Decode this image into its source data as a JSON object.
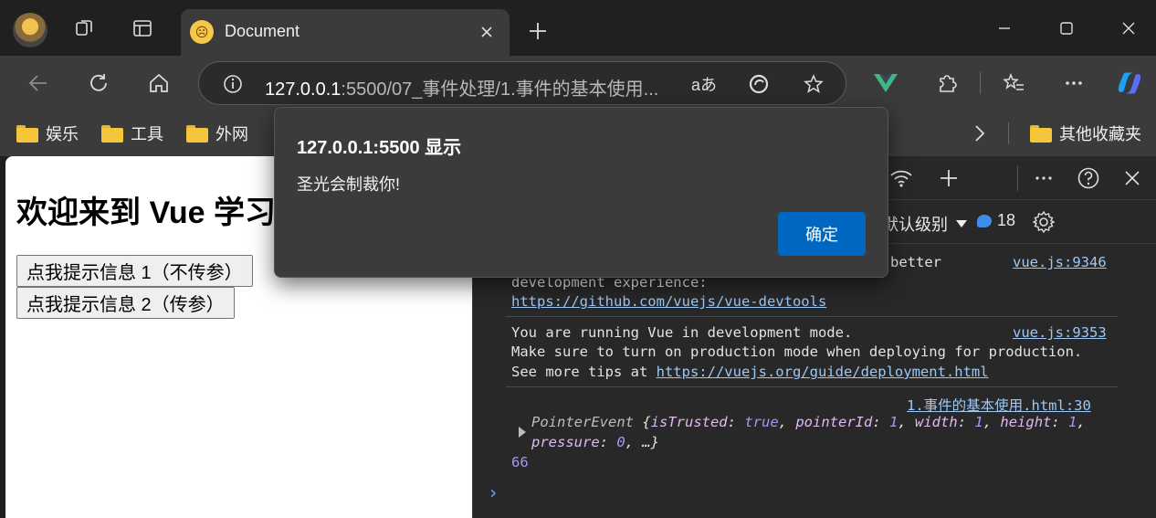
{
  "browser": {
    "tab": {
      "title": "Document"
    },
    "address": {
      "host": "127.0.0.1",
      "rest": ":5500/07_事件处理/1.事件的基本使用...",
      "read_aloud": "aあ"
    },
    "favorites": [
      "娱乐",
      "工具",
      "外网"
    ],
    "other_favorites": "其他收藏夹"
  },
  "page": {
    "heading": "欢迎来到 Vue 学习",
    "buttons": [
      "点我提示信息 1（不传参）",
      "点我提示信息 2（传参）"
    ]
  },
  "dialog": {
    "title": "127.0.0.1:5500 显示",
    "message": "圣光会制裁你!",
    "ok_label": "确定"
  },
  "devtools": {
    "level_label": "默认级别",
    "issue_count": "18",
    "console": {
      "msg1_line1": "better",
      "msg1_line2": "development experience:",
      "msg1_link": "https://github.com/vuejs/vue-devtools",
      "msg1_src": "vue.js:9346",
      "msg2_line1": "You are running Vue in development mode.",
      "msg2_line2": "Make sure to turn on production mode when deploying for production.",
      "msg2_line3_prefix": "See more tips at ",
      "msg2_link": "https://vuejs.org/guide/deployment.html",
      "msg2_src": "vue.js:9353",
      "msg3_src": "1.事件的基本使用.html:30",
      "event_name": "PointerEvent",
      "k_isTrusted": "isTrusted",
      "v_isTrusted": "true",
      "k_pointerId": "pointerId",
      "v_pointerId": "1",
      "k_width": "width",
      "v_width": "1",
      "k_height": "height",
      "v_height": "1",
      "k_pressure": "pressure",
      "v_pressure": "0",
      "value_66": "66"
    }
  },
  "colors": {
    "accent": "#0067c0",
    "link": "#9cc8f5",
    "vue_green": "#41b883"
  }
}
